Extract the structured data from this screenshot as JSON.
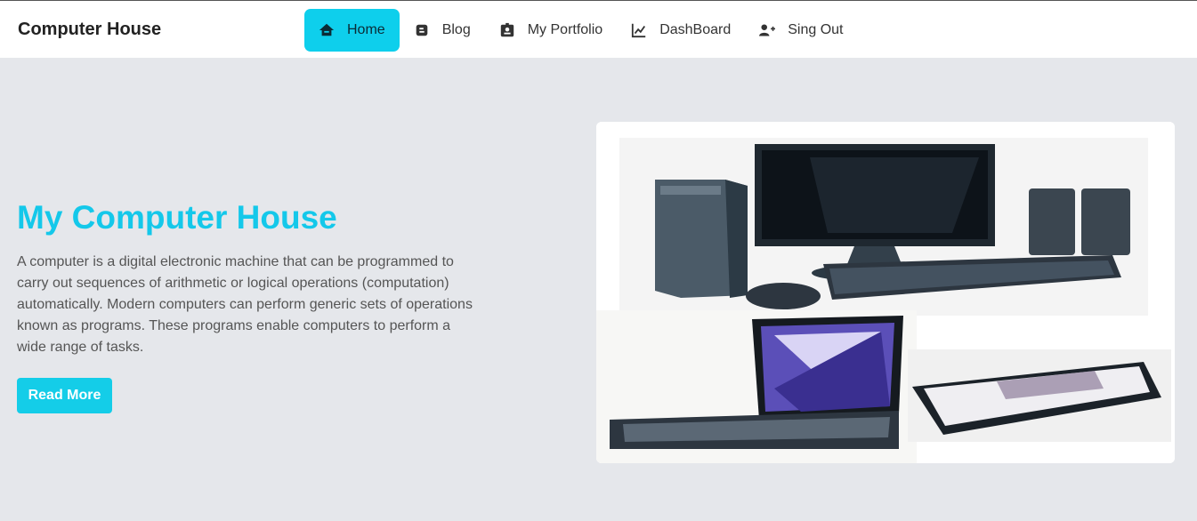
{
  "brand": {
    "name": "Computer House"
  },
  "nav": {
    "items": [
      {
        "label": "Home",
        "icon": "home-icon",
        "active": true
      },
      {
        "label": "Blog",
        "icon": "blog-icon",
        "active": false
      },
      {
        "label": "My Portfolio",
        "icon": "id-badge-icon",
        "active": false
      },
      {
        "label": "DashBoard",
        "icon": "chart-line-icon",
        "active": false
      },
      {
        "label": "Sing Out",
        "icon": "user-plus-icon",
        "active": false
      }
    ]
  },
  "hero": {
    "title": "My Computer House",
    "text": "A computer is a digital electronic machine that can be programmed to carry out sequences of arithmetic or logical operations (computation) automatically. Modern computers can perform generic sets of operations known as programs. These programs enable computers to perform a wide range of tasks.",
    "button_label": "Read More"
  },
  "colors": {
    "accent": "#0ecfec",
    "title": "#14c8ea",
    "background": "#e5e7eb"
  }
}
